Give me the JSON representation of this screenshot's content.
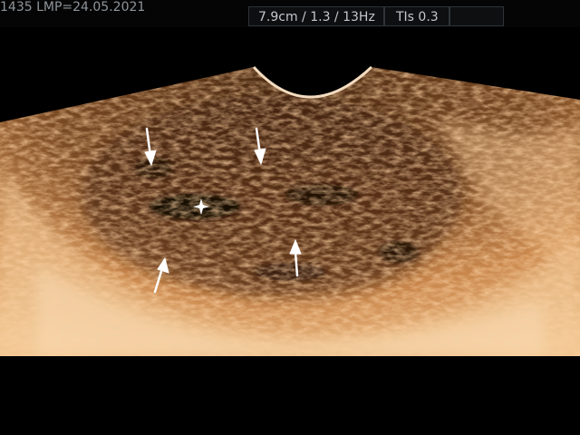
{
  "header": {
    "patient_info": "1435  LMP=24.05.2021",
    "depth_freq": "7.9cm / 1.3 / 13Hz",
    "tis": "TIs  0.3"
  },
  "image": {
    "description_icon": "ultrasound-sector-scan",
    "tint_color": "#c8864a",
    "annotations": [
      "arrow",
      "arrow",
      "arrow",
      "arrow",
      "star-marker"
    ]
  }
}
